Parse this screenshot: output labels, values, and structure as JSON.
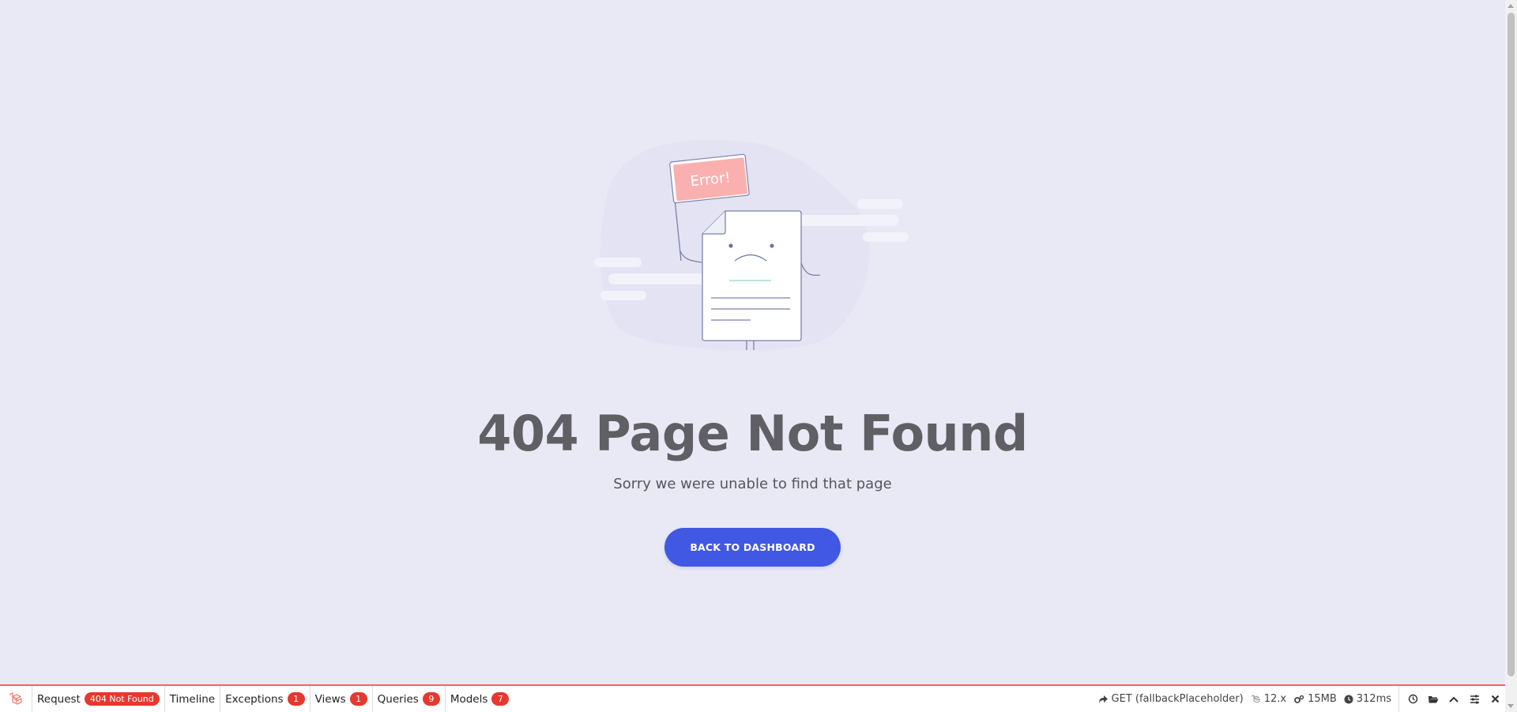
{
  "illustration": {
    "flag_text": "Error!"
  },
  "main": {
    "title": "404 Page Not Found",
    "subtitle": "Sorry we were unable to find that page",
    "button_label": "BACK TO DASHBOARD"
  },
  "debugbar": {
    "tabs": [
      {
        "label": "Request",
        "badge": "404 Not Found"
      },
      {
        "label": "Timeline",
        "badge": ""
      },
      {
        "label": "Exceptions",
        "badge": "1"
      },
      {
        "label": "Views",
        "badge": "1"
      },
      {
        "label": "Queries",
        "badge": "9"
      },
      {
        "label": "Models",
        "badge": "7"
      }
    ],
    "route": "GET (fallbackPlaceholder)",
    "version": "12.x",
    "memory": "15MB",
    "duration": "312ms",
    "accent_color": "#f4645f",
    "badge_color": "#e6382e",
    "icons": [
      "history-icon",
      "folder-open-icon",
      "chevron-up-icon",
      "settings-icon",
      "close-icon"
    ]
  },
  "colors": {
    "background": "#e9e9f5",
    "button": "#4058e3",
    "title": "#5f5f64"
  }
}
